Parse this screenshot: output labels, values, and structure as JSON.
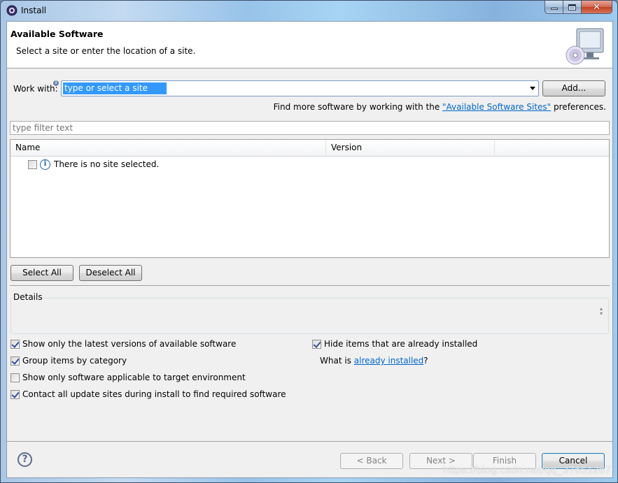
{
  "window": {
    "title": "Install",
    "controls": {
      "minimize": "minimize",
      "maximize": "maximize",
      "close": "✕"
    }
  },
  "header": {
    "title": "Available Software",
    "description": "Select a site or enter the location of a site.",
    "image": "computer-with-cd-icon"
  },
  "work_with": {
    "label": "Work with:",
    "value": "type or select a site",
    "info_marker": "i",
    "add_button": "Add..."
  },
  "find_more": {
    "prefix": "Find more software by working with the ",
    "link": "\"Available Software Sites\"",
    "suffix": " preferences."
  },
  "filter": {
    "placeholder": "type filter text"
  },
  "table": {
    "columns": [
      "Name",
      "Version",
      ""
    ],
    "rows": [
      {
        "checked": false,
        "icon": "info-icon",
        "text": "There is no site selected."
      }
    ]
  },
  "selection_buttons": {
    "select_all": "Select All",
    "deselect_all": "Deselect All"
  },
  "details": {
    "label": "Details",
    "content": ""
  },
  "options": {
    "latest_versions": {
      "label": "Show only the latest versions of available software",
      "checked": true
    },
    "group_by_category": {
      "label": "Group items by category",
      "checked": true
    },
    "target_env": {
      "label": "Show only software applicable to target environment",
      "checked": false
    },
    "contact_sites": {
      "label": "Contact all update sites during install to find required software",
      "checked": true
    },
    "hide_installed": {
      "label": "Hide items that are already installed",
      "checked": true
    },
    "what_is": {
      "prefix": "What is ",
      "link": "already installed",
      "suffix": "?"
    }
  },
  "footer": {
    "help": "?",
    "back": "< Back",
    "next": "Next >",
    "finish": "Finish",
    "cancel": "Cancel"
  },
  "watermark": "https://blog.csdn.net/qq_37651267"
}
